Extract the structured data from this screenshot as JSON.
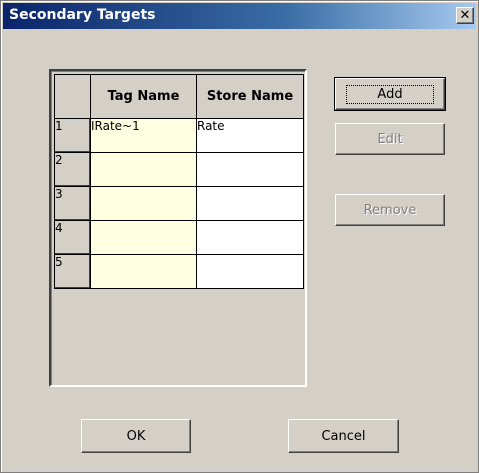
{
  "window": {
    "title": "Secondary Targets",
    "close_glyph": "✕",
    "close_icon": "close-icon"
  },
  "grid": {
    "columns": [
      "",
      "Tag Name",
      "Store Name"
    ],
    "rows": [
      {
        "num": "1",
        "tag": "IRate~1",
        "store": "Rate"
      },
      {
        "num": "2",
        "tag": "",
        "store": ""
      },
      {
        "num": "3",
        "tag": "",
        "store": ""
      },
      {
        "num": "4",
        "tag": "",
        "store": ""
      },
      {
        "num": "5",
        "tag": "",
        "store": ""
      }
    ],
    "colors": {
      "tag_cell_bg": "#ffffe1",
      "store_cell_bg": "#ffffff"
    }
  },
  "buttons": {
    "add": "Add",
    "edit": "Edit",
    "remove": "Remove",
    "ok": "OK",
    "cancel": "Cancel"
  },
  "colors": {
    "dialog_bg": "#d4d0c8",
    "title_gradient_start": "#0a246a",
    "title_gradient_end": "#a6caf0",
    "disabled_text": "#808080"
  }
}
